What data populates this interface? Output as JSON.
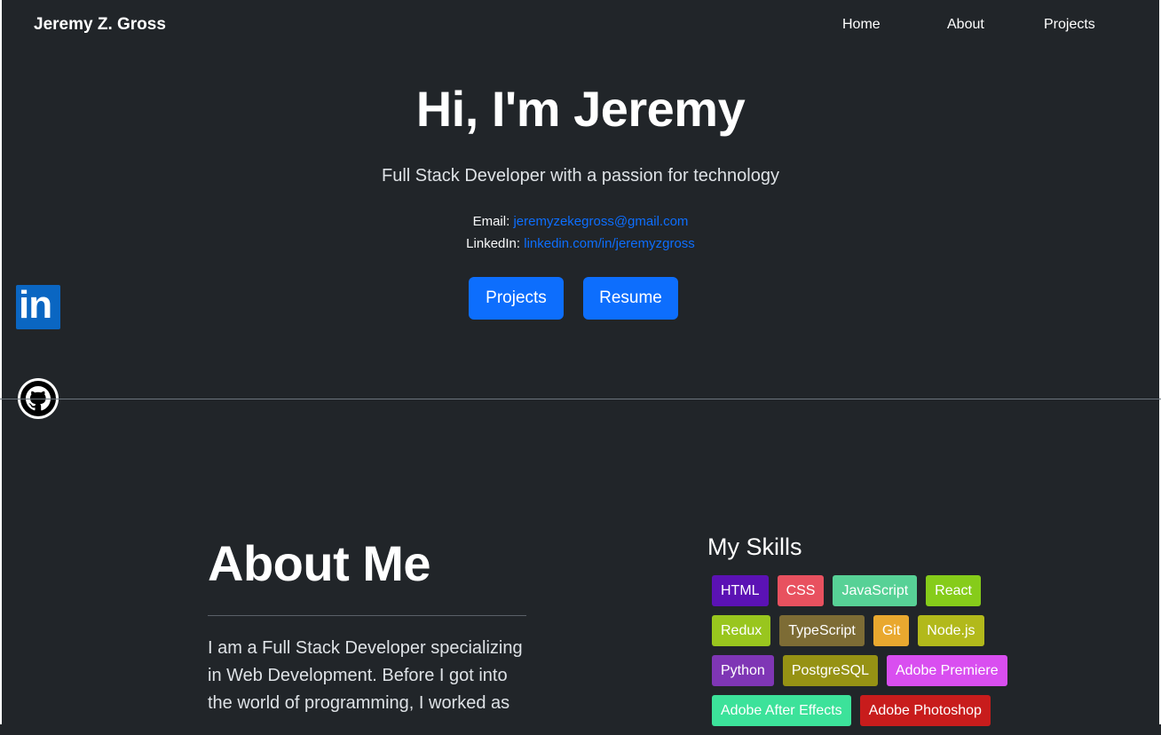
{
  "nav": {
    "brand": "Jeremy Z. Gross",
    "links": [
      "Home",
      "About",
      "Projects"
    ]
  },
  "hero": {
    "title": "Hi, I'm Jeremy",
    "subtitle": "Full Stack Developer with a passion for technology",
    "email_label": "Email:",
    "email": "jeremyzekegross@gmail.com",
    "linkedin_label": "LinkedIn:",
    "linkedin": "linkedin.com/in/jeremyzgross",
    "buttons": [
      "Projects",
      "Resume"
    ],
    "accent_color": "#0d6efd"
  },
  "social": {
    "linkedin_icon": "linkedin-icon",
    "github_icon": "github-icon",
    "linkedin_glyph": "in"
  },
  "about": {
    "title": "About Me",
    "text": "I am a Full Stack Developer specializing in Web Development. Before I got into the world of programming, I worked as"
  },
  "skills": {
    "title": "My Skills",
    "rows": [
      [
        {
          "label": "HTML",
          "color": "#5b12b4"
        },
        {
          "label": "CSS",
          "color": "#e8515f"
        },
        {
          "label": "JavaScript",
          "color": "#57d196"
        },
        {
          "label": "React",
          "color": "#86cc1a"
        }
      ],
      [
        {
          "label": "Redux",
          "color": "#99c61e"
        },
        {
          "label": "TypeScript",
          "color": "#7d6c35"
        },
        {
          "label": "Git",
          "color": "#e9a82f"
        },
        {
          "label": "Node.js",
          "color": "#b2b91b"
        }
      ],
      [
        {
          "label": "Python",
          "color": "#7f36b5"
        },
        {
          "label": "PostgreSQL",
          "color": "#969214"
        },
        {
          "label": "Adobe Premiere",
          "color": "#d94ef0"
        }
      ],
      [
        {
          "label": "Adobe After Effects",
          "color": "#3ce29a"
        },
        {
          "label": "Adobe Photoshop",
          "color": "#c81c1c"
        }
      ]
    ]
  }
}
